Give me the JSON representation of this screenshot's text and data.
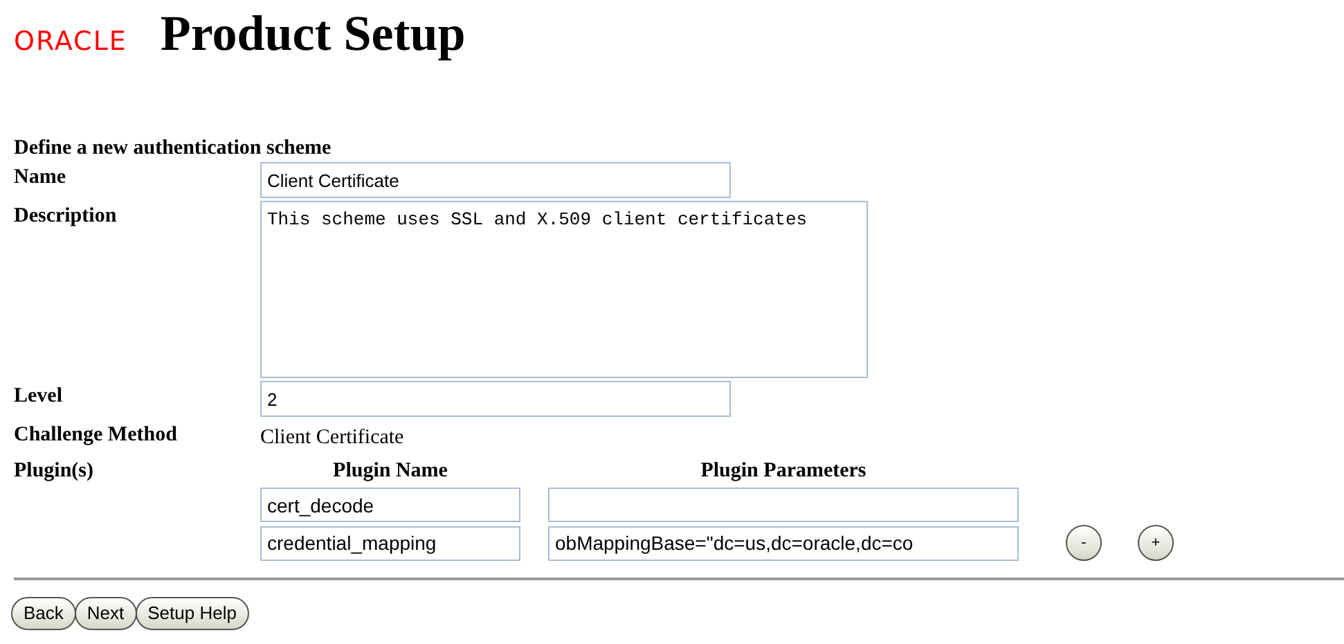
{
  "header": {
    "logo": "ORACLE",
    "title": "Product Setup"
  },
  "form": {
    "heading": "Define a new authentication scheme",
    "fields": [
      {
        "kind": "input",
        "label": "Name",
        "value": "Client Certificate"
      },
      {
        "kind": "textarea",
        "label": "Description",
        "value": "This scheme uses SSL and X.509 client certificates"
      },
      {
        "kind": "input",
        "label": "Level",
        "value": "2"
      },
      {
        "kind": "text",
        "label": "Challenge Method",
        "value": "Client Certificate"
      }
    ],
    "plugins": {
      "label": "Plugin(s)",
      "columns": [
        "Plugin Name",
        "Plugin Parameters"
      ],
      "rows": [
        {
          "name": "cert_decode",
          "parameters": ""
        },
        {
          "name": "credential_mapping",
          "parameters": "obMappingBase=\"dc=us,dc=oracle,dc=co"
        }
      ],
      "row_buttons": [
        "-",
        "+"
      ]
    }
  },
  "buttons": [
    "Back",
    "Next",
    "Setup Help"
  ]
}
